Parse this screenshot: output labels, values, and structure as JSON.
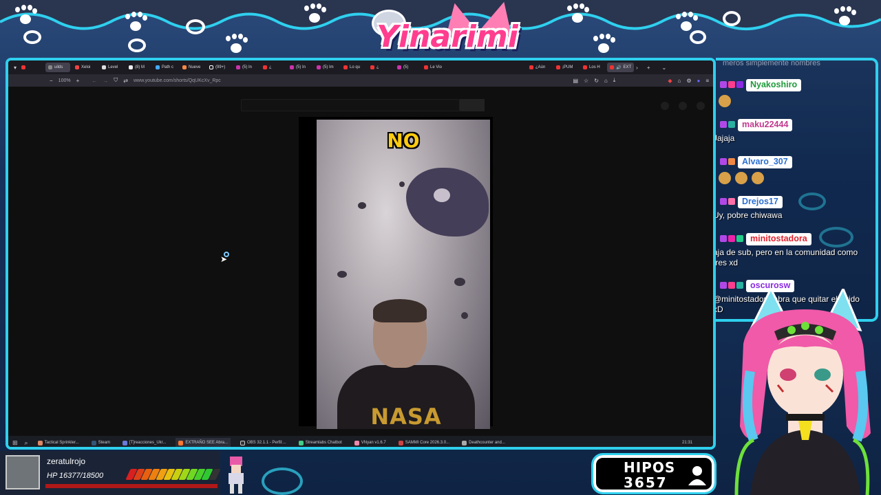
{
  "overlay": {
    "logo_text": "Yinarimi",
    "accent_color": "#2fd0ee",
    "pink_color": "#ff3d8f"
  },
  "browser": {
    "tabs": [
      {
        "label": ""
      },
      {
        "label": "uilds"
      },
      {
        "label": "Xeloi"
      },
      {
        "label": "Level"
      },
      {
        "label": "(8) M"
      },
      {
        "label": "Path c"
      },
      {
        "label": "Nueve"
      },
      {
        "label": "(99+)"
      },
      {
        "label": "(5) In"
      },
      {
        "label": "¿"
      },
      {
        "label": "(5) In"
      },
      {
        "label": "(5) Im"
      },
      {
        "label": "Lo qu"
      },
      {
        "label": "¿"
      },
      {
        "label": "(5)"
      },
      {
        "label": "Le Vio"
      },
      {
        "label": "¿Aún"
      },
      {
        "label": "¡PUM"
      },
      {
        "label": "Los H"
      },
      {
        "label": "EXT"
      }
    ],
    "zoom": "100%",
    "url": "www.youtube.com/shorts/QqUKcXv_Rpc",
    "nav_icons": [
      "minus-icon",
      "plus-icon",
      "back-icon",
      "forward-icon",
      "shield-icon",
      "tracking-icon"
    ],
    "toolbar_icons": [
      "reader-icon",
      "bookmark-icon",
      "reload-icon",
      "home-icon",
      "download-icon",
      "extension-icon",
      "lock-icon",
      "gear-icon",
      "profile-icon",
      "menu-icon"
    ]
  },
  "video": {
    "caption": "NO",
    "shirt_text": "NASA"
  },
  "taskbar": {
    "items": [
      {
        "label": "Tactical Sprinkler..."
      },
      {
        "label": "Steam"
      },
      {
        "label": "[T]reacciones_Ukr..."
      },
      {
        "label": "EXTRAÑO SEE Abra..."
      },
      {
        "label": "OBS 32.1.1 - Perfil:..."
      },
      {
        "label": "Streamlabs Chatbot"
      },
      {
        "label": "VNyan v1.6.7"
      },
      {
        "label": "SAMMI Core 2026.3.0..."
      },
      {
        "label": "Deathcounter and..."
      }
    ],
    "clock": "21:31"
  },
  "chat": {
    "partial_top": "meros simplemente nombres",
    "messages": [
      {
        "user": "Nyakoshiro",
        "color": "#1e9b3a",
        "text": ""
      },
      {
        "user": "maku22444",
        "color": "#c23a8e",
        "text": "Jajaja"
      },
      {
        "user": "Alvaro_307",
        "color": "#2a6fd0",
        "text": ""
      },
      {
        "user": "Drejos17",
        "color": "#2a6fd0",
        "text": "Uy, pobre chiwawa"
      },
      {
        "user": "minitostadora",
        "color": "#e0222e",
        "text": "aja de sub, pero en la comunidad como tres xd"
      },
      {
        "user": "oscurosw",
        "color": "#8a2be2",
        "text": "@minitostadora abra que quitar el oxido xD"
      }
    ]
  },
  "player": {
    "name": "zeratulrojo",
    "hp_text": "HP 16377/18500",
    "hp_fraction": 0.885
  },
  "counter": {
    "label": "HIPOS",
    "value": "3657"
  }
}
